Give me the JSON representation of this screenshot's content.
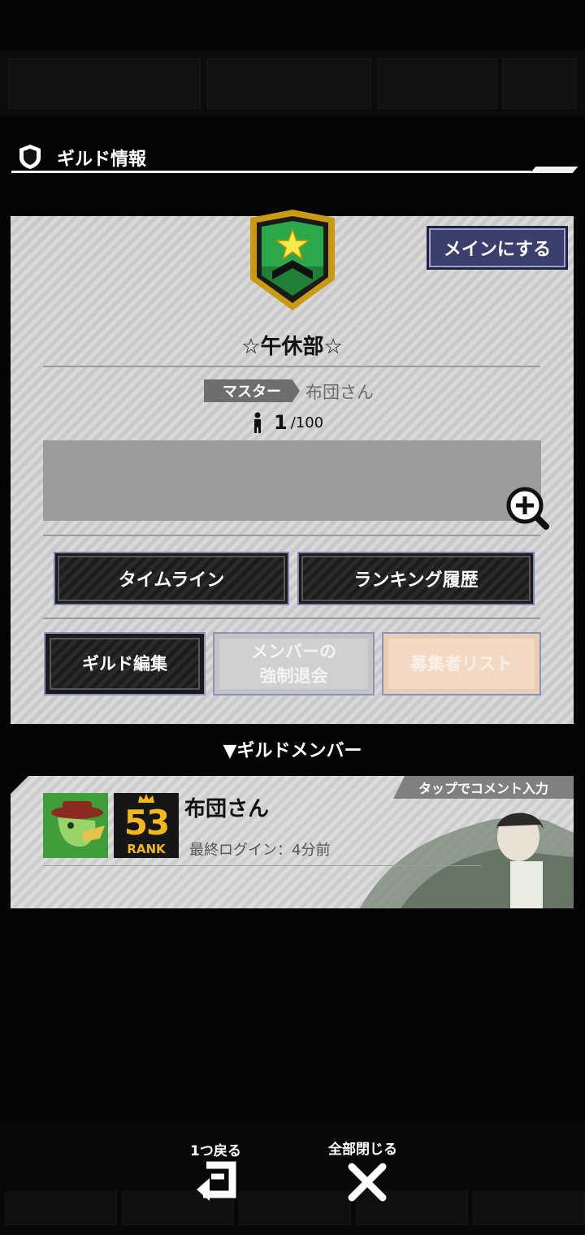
{
  "header": {
    "title": "ギルド情報"
  },
  "guild": {
    "main_button": "メインにする",
    "name": "☆午休部☆",
    "master_label": "マスター",
    "master_name": "布団さん",
    "member_count": "1",
    "member_max": "/100"
  },
  "buttons": {
    "timeline": "タイムライン",
    "ranking_history": "ランキング履歴",
    "guild_edit": "ギルド編集",
    "force_leave": "メンバーの\n強制退会",
    "recruit_list": "募集者リスト"
  },
  "members_section": {
    "title": "▼ギルドメンバー",
    "tap_hint": "タップでコメント入力",
    "members": [
      {
        "name": "布団さん",
        "rank": "53",
        "rank_word": "RANK",
        "last_login": "最終ログイン：4分前"
      }
    ]
  },
  "footer": {
    "back_label": "1つ戻る",
    "close_all_label": "全部閉じる"
  },
  "colors": {
    "panel": "#d4d4d4",
    "dark_button": "#222222",
    "main_button": "#3a3f6e",
    "emblem_gold": "#c99a12",
    "emblem_green": "#2aa84a",
    "disabled_button": "#d0d0d0",
    "recruit_button": "#f3d9c4"
  }
}
